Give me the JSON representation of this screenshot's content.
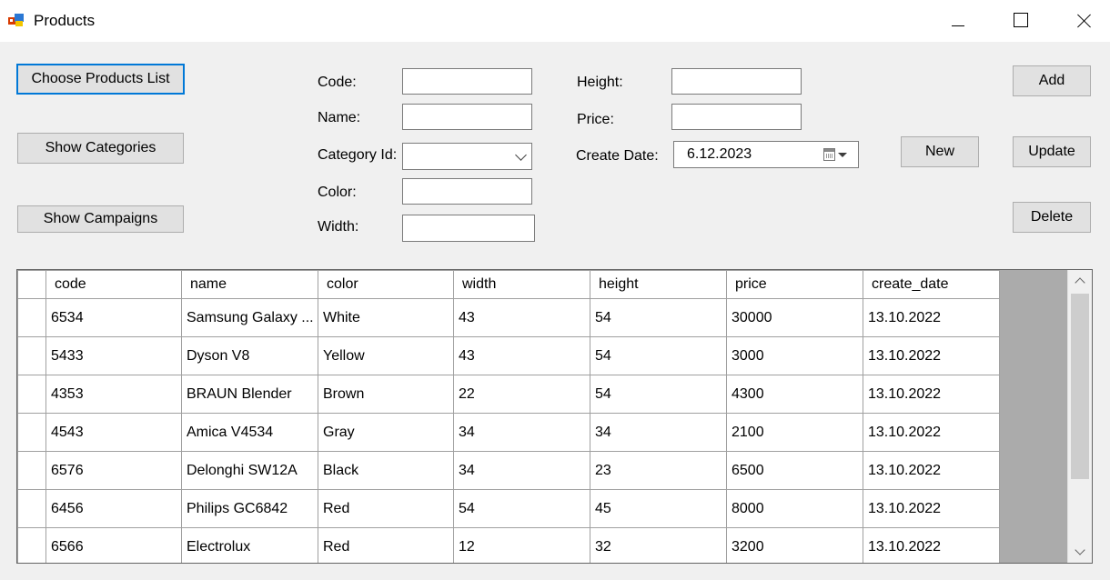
{
  "window": {
    "title": "Products"
  },
  "buttons": {
    "choose_products": "Choose Products List",
    "show_categories": "Show Categories",
    "show_campaigns": "Show Campaigns",
    "add": "Add",
    "new": "New",
    "update": "Update",
    "delete": "Delete"
  },
  "form": {
    "code_label": "Code:",
    "name_label": "Name:",
    "category_label": "Category Id:",
    "color_label": "Color:",
    "width_label": "Width:",
    "height_label": "Height:",
    "price_label": "Price:",
    "create_date_label": "Create Date:",
    "create_date_value": "6.12.2023"
  },
  "grid": {
    "columns": [
      "code",
      "name",
      "color",
      "width",
      "height",
      "price",
      "create_date"
    ],
    "rows": [
      [
        "6534",
        "Samsung Galaxy ...",
        "White",
        "43",
        "54",
        "30000",
        "13.10.2022"
      ],
      [
        "5433",
        "Dyson V8",
        "Yellow",
        "43",
        "54",
        "3000",
        "13.10.2022"
      ],
      [
        "4353",
        "BRAUN Blender",
        "Brown",
        "22",
        "54",
        "4300",
        "13.10.2022"
      ],
      [
        "4543",
        "Amica V4534",
        "Gray",
        "34",
        "34",
        "2100",
        "13.10.2022"
      ],
      [
        "6576",
        "Delonghi SW12A",
        "Black",
        "34",
        "23",
        "6500",
        "13.10.2022"
      ],
      [
        "6456",
        "Philips GC6842",
        "Red",
        "54",
        "45",
        "8000",
        "13.10.2022"
      ],
      [
        "6566",
        "Electrolux",
        "Red",
        "12",
        "32",
        "3200",
        "13.10.2022"
      ]
    ]
  },
  "icons": {
    "app": "app-icon",
    "calendar": "calendar-icon"
  }
}
